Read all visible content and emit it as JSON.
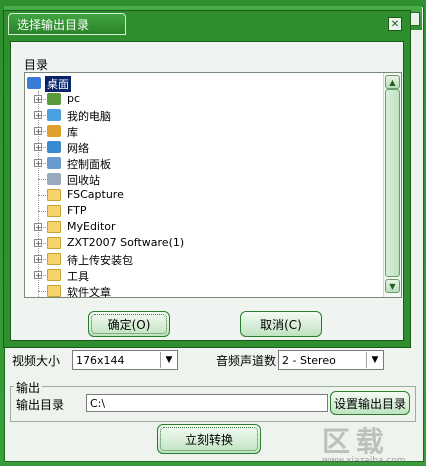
{
  "dialog": {
    "title": "选择输出目录",
    "close_icon": "close-icon",
    "directory_label": "目录",
    "tree_items": [
      {
        "label": "桌面",
        "icon": "desktop-icon",
        "selected": true
      },
      {
        "label": "pc",
        "icon": "user-icon"
      },
      {
        "label": "我的电脑",
        "icon": "computer-icon"
      },
      {
        "label": "库",
        "icon": "library-icon"
      },
      {
        "label": "网络",
        "icon": "network-icon"
      },
      {
        "label": "控制面板",
        "icon": "control-panel-icon"
      },
      {
        "label": "回收站",
        "icon": "recycle-bin-icon"
      },
      {
        "label": "FSCapture",
        "icon": "folder-icon"
      },
      {
        "label": "FTP",
        "icon": "folder-icon"
      },
      {
        "label": "MyEditor",
        "icon": "folder-icon"
      },
      {
        "label": "ZXT2007 Software(1)",
        "icon": "folder-icon"
      },
      {
        "label": "待上传安装包",
        "icon": "folder-icon"
      },
      {
        "label": "工具",
        "icon": "folder-icon"
      },
      {
        "label": "软件文章",
        "icon": "folder-icon"
      }
    ],
    "ok_label": "确定(O)",
    "cancel_label": "取消(C)"
  },
  "main": {
    "video_size_label": "视频大小",
    "video_size_value": "176x144",
    "audio_channels_label": "音频声道数",
    "audio_channels_value": "2 - Stereo",
    "output_group_label": "输出",
    "output_dir_label": "输出目录",
    "output_dir_value": "C:\\",
    "set_output_dir_label": "设置输出目录",
    "convert_label": "立刻转换"
  },
  "colors": {
    "accent": "#2f8f2f",
    "accent_light": "#bfe3bf",
    "selection": "#0a246a"
  },
  "watermark": {
    "text": "区 载",
    "sub": "www.xiazaiba.com"
  }
}
